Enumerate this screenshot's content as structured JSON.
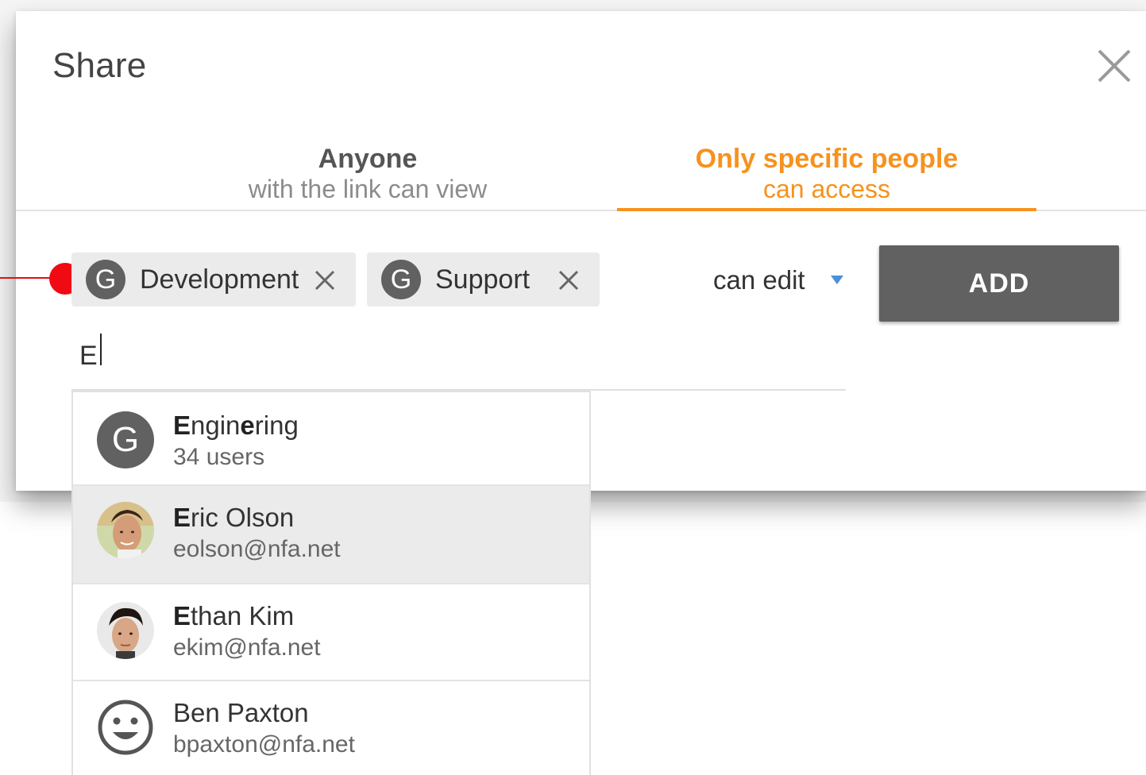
{
  "dialog": {
    "title": "Share",
    "close_icon": "close-icon"
  },
  "tabs": [
    {
      "title": "Anyone",
      "subtitle": "with the link can view",
      "active": false
    },
    {
      "title": "Only specific people",
      "subtitle": "can access",
      "active": true
    }
  ],
  "accent_color": "#f6921e",
  "chips": [
    {
      "avatar_letter": "G",
      "label": "Development",
      "remove_icon": "close-icon"
    },
    {
      "avatar_letter": "G",
      "label": "Support",
      "remove_icon": "close-icon"
    }
  ],
  "permission": {
    "selected": "can edit",
    "icon": "caret-down-icon"
  },
  "add_button": {
    "label": "ADD"
  },
  "search": {
    "value": "E"
  },
  "suggestions": [
    {
      "name_match": "E",
      "name_rest": "ngineering",
      "name_match2": "e",
      "name_rest2": "ring",
      "name_mid": "ngin",
      "subtitle": "34 users",
      "avatar": "group-avatar",
      "avatar_letter": "G",
      "highlighted": false
    },
    {
      "name_match": "E",
      "name_rest": "ric Olson",
      "subtitle": "eolson@nfa.net",
      "avatar": "user-photo",
      "highlighted": true
    },
    {
      "name_match": "E",
      "name_rest": "than Kim",
      "subtitle": "ekim@nfa.net",
      "avatar": "user-photo",
      "highlighted": false
    },
    {
      "name_match": "",
      "name_rest": "Ben Paxton",
      "subtitle": "bpaxton@nfa.net",
      "avatar": "smiley-icon",
      "highlighted": false
    }
  ]
}
